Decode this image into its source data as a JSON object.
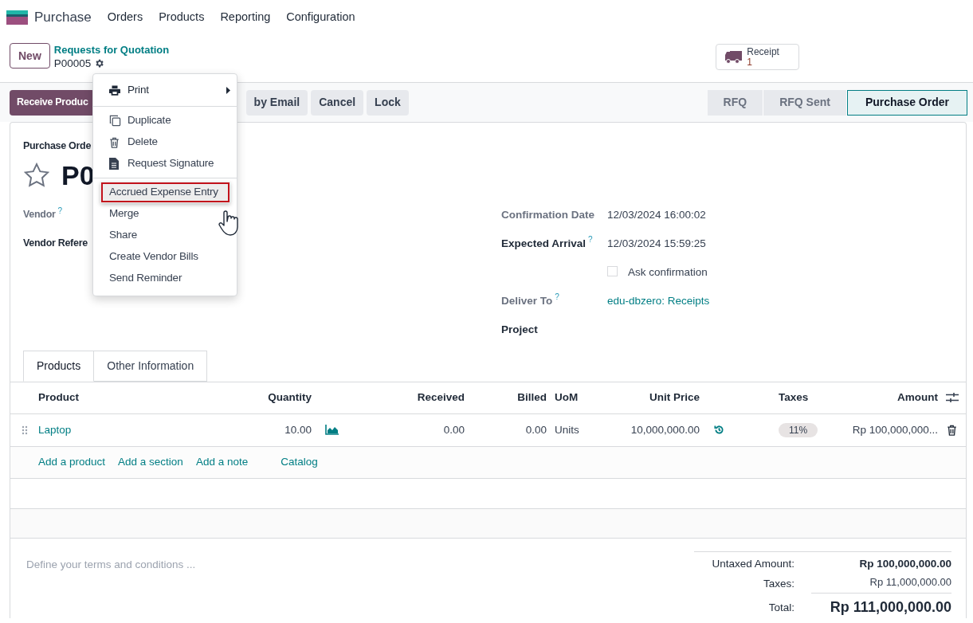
{
  "navbar": {
    "app": "Purchase",
    "menus": [
      "Orders",
      "Products",
      "Reporting",
      "Configuration"
    ]
  },
  "control_panel": {
    "new_button": "New",
    "breadcrumb": "Requests for Quotation",
    "record": "P00005",
    "stat_button": {
      "label": "Receipt",
      "value": "1"
    }
  },
  "action_buttons": [
    {
      "label": "Receive Produc",
      "primary": true
    },
    {
      "label": "by Email",
      "primary": false
    },
    {
      "label": "Cancel",
      "primary": false
    },
    {
      "label": "Lock",
      "primary": false
    }
  ],
  "status_stages": [
    {
      "label": "RFQ",
      "selected": false
    },
    {
      "label": "RFQ Sent",
      "selected": false
    },
    {
      "label": "Purchase Order",
      "selected": true
    }
  ],
  "form": {
    "title_label": "Purchase Orde",
    "name": "P0",
    "starred": false,
    "left_fields": [
      {
        "label": "Vendor",
        "help": "?",
        "readonly": true
      },
      {
        "label": "Vendor Refere",
        "readonly": false
      }
    ],
    "right_fields": [
      {
        "label": "Confirmation Date",
        "value": "12/03/2024 16:00:02",
        "readonly": true,
        "kind": "text"
      },
      {
        "label": "Expected Arrival",
        "help": "?",
        "value": "12/03/2024 15:59:25",
        "readonly": false,
        "kind": "text"
      },
      {
        "label": "Ask confirmation",
        "checked": false,
        "kind": "checkbox"
      },
      {
        "label": "Deliver To",
        "help": "?",
        "value": "edu-dbzero: Receipts",
        "readonly": true,
        "kind": "link"
      },
      {
        "label": "Project",
        "readonly": false,
        "kind": "text"
      }
    ]
  },
  "tabs": [
    {
      "label": "Products",
      "selected": true
    },
    {
      "label": "Other Information",
      "selected": false
    }
  ],
  "table": {
    "columns": [
      "Product",
      "Quantity",
      "Received",
      "Billed",
      "UoM",
      "Unit Price",
      "Taxes",
      "Amount"
    ],
    "rows": [
      {
        "product": "Laptop",
        "quantity": "10.00",
        "received": "0.00",
        "billed": "0.00",
        "uom": "Units",
        "unit_price": "10,000,000.00",
        "taxes": "11%",
        "amount": "Rp 100,000,000..."
      }
    ],
    "add_links": [
      "Add a product",
      "Add a section",
      "Add a note",
      "Catalog"
    ]
  },
  "terms": {
    "placeholder": "Define your terms and conditions ..."
  },
  "totals": [
    {
      "label": "Untaxed Amount:",
      "value": "Rp 100,000,000.00",
      "kind": "subtotal"
    },
    {
      "label": "Taxes:",
      "value": "Rp 11,000,000.00",
      "kind": "tax"
    },
    {
      "label": "Total:",
      "value": "Rp 111,000,000.00",
      "kind": "total"
    }
  ],
  "action_menu": {
    "groups": [
      [
        {
          "label": "Print",
          "kind": "submenu",
          "selected": false
        }
      ],
      [
        {
          "label": "Duplicate",
          "kind": "icon",
          "selected": false
        },
        {
          "label": "Delete",
          "kind": "icon",
          "selected": false
        },
        {
          "label": "Request Signature",
          "kind": "icon",
          "selected": false
        }
      ],
      [
        {
          "label": "Accrued Expense Entry",
          "kind": "plain",
          "selected": true
        },
        {
          "label": "Merge",
          "kind": "plain",
          "selected": false
        },
        {
          "label": "Share",
          "kind": "plain",
          "selected": false
        },
        {
          "label": "Create Vendor Bills",
          "kind": "plain",
          "selected": false
        },
        {
          "label": "Send Reminder",
          "kind": "plain",
          "selected": false
        }
      ]
    ]
  }
}
